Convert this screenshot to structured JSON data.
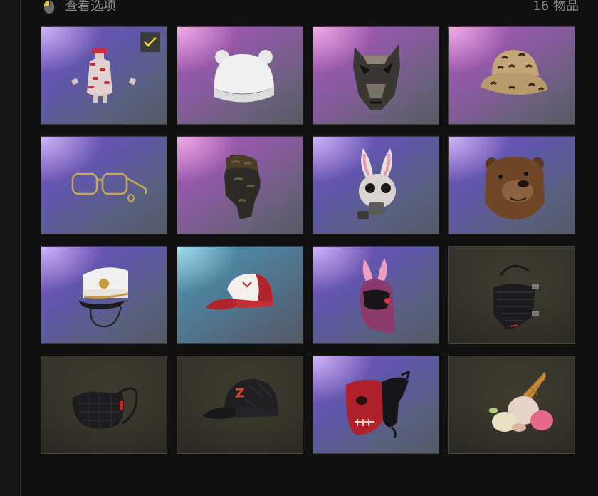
{
  "header": {
    "title": "查看选项",
    "item_count": "16 物品"
  },
  "items": [
    {
      "icon": "dress-outfit-icon",
      "bg": "purple",
      "selected": true
    },
    {
      "icon": "white-bear-beanie-icon",
      "bg": "pink",
      "selected": false
    },
    {
      "icon": "wolf-mask-icon",
      "bg": "pink",
      "selected": false
    },
    {
      "icon": "leopard-bucket-hat-icon",
      "bg": "pink",
      "selected": false
    },
    {
      "icon": "gold-glasses-icon",
      "bg": "purple",
      "selected": false
    },
    {
      "icon": "camo-face-mask-icon",
      "bg": "pink",
      "selected": false
    },
    {
      "icon": "bunny-gas-mask-icon",
      "bg": "purple",
      "selected": false
    },
    {
      "icon": "bear-head-mask-icon",
      "bg": "purple",
      "selected": false
    },
    {
      "icon": "white-captain-hat-icon",
      "bg": "purple",
      "selected": false
    },
    {
      "icon": "red-white-cap-icon",
      "bg": "blue",
      "selected": false
    },
    {
      "icon": "pink-bunny-helmet-icon",
      "bg": "purple",
      "selected": false
    },
    {
      "icon": "black-tactical-mask-icon",
      "bg": "dark",
      "selected": false
    },
    {
      "icon": "black-face-mask-icon",
      "bg": "dark",
      "selected": false
    },
    {
      "icon": "black-baseball-cap-icon",
      "bg": "dark",
      "selected": false
    },
    {
      "icon": "red-skull-mask-icon",
      "bg": "purple",
      "selected": false
    },
    {
      "icon": "ice-cream-hat-icon",
      "bg": "dark",
      "selected": false
    }
  ]
}
